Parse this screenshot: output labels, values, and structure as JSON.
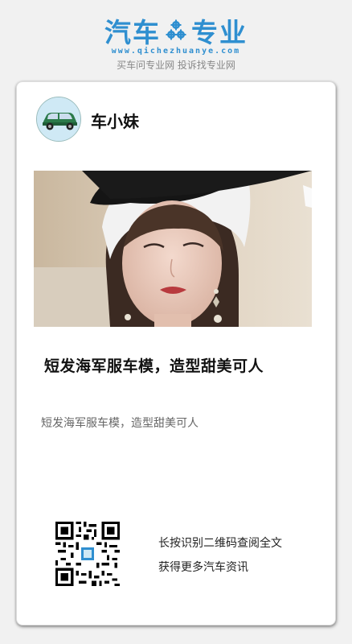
{
  "header": {
    "brand_left": "汽车",
    "brand_right": "专业",
    "url": "www.qichezhuanye.com",
    "slogan": "买车问专业网 投诉找专业网",
    "brand_color": "#2f8fd0"
  },
  "card": {
    "author": "车小妹",
    "title": "短发海军服车模，造型甜美可人",
    "summary": "短发海军服车模，造型甜美可人",
    "qr_line1": "长按识别二维码查阅全文",
    "qr_line2": "获得更多汽车资讯"
  },
  "icons": {
    "logo_gear": "gear-icon",
    "avatar": "car-icon",
    "qr": "qr-code-icon"
  }
}
